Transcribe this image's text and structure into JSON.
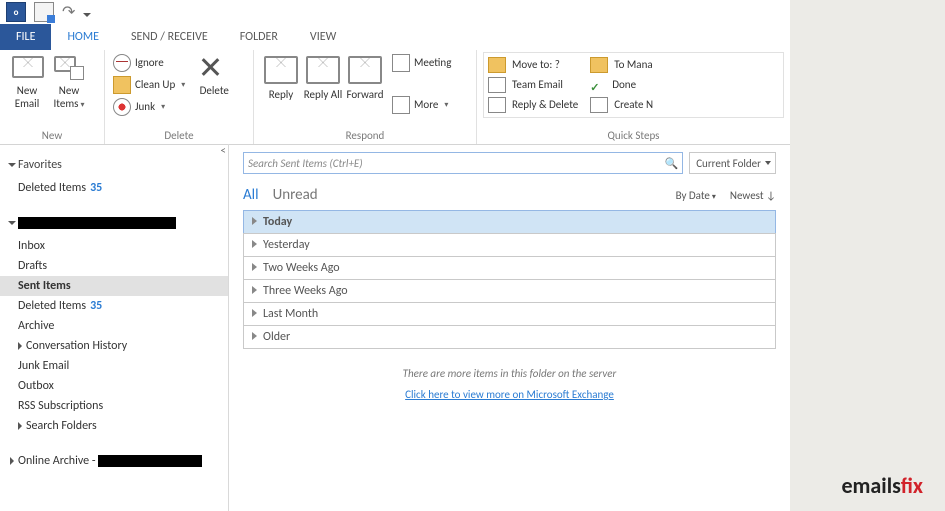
{
  "tabs": [
    "FILE",
    "HOME",
    "SEND / RECEIVE",
    "FOLDER",
    "VIEW"
  ],
  "ribbon": {
    "new": {
      "group": "New",
      "newEmail": "New Email",
      "newItems": "New Items"
    },
    "delete": {
      "group": "Delete",
      "ignore": "Ignore",
      "cleanup": "Clean Up",
      "junk": "Junk",
      "delete": "Delete"
    },
    "respond": {
      "group": "Respond",
      "reply": "Reply",
      "replyAll": "Reply All",
      "forward": "Forward",
      "meeting": "Meeting",
      "more": "More"
    },
    "qs": {
      "group": "Quick Steps",
      "moveTo": "Move to: ?",
      "teamEmail": "Team Email",
      "replyDelete": "Reply & Delete",
      "toManager": "To Mana",
      "done": "Done",
      "createNew": "Create N"
    }
  },
  "nav": {
    "favorites": "Favorites",
    "favItems": [
      {
        "label": "Deleted Items",
        "count": "35"
      }
    ],
    "folders": [
      "Inbox",
      "Drafts",
      "Sent Items",
      "Deleted Items",
      "Archive",
      "Conversation History",
      "Junk Email",
      "Outbox",
      "RSS Subscriptions",
      "Search Folders"
    ],
    "deletedCount": "35",
    "onlineArchive": "Online Archive -"
  },
  "search": {
    "placeholder": "Search Sent Items (Ctrl+E)",
    "scope": "Current Folder"
  },
  "list": {
    "filters": [
      "All",
      "Unread"
    ],
    "sortBy": "By Date",
    "sortDir": "Newest",
    "groups": [
      "Today",
      "Yesterday",
      "Two Weeks Ago",
      "Three Weeks Ago",
      "Last Month",
      "Older"
    ],
    "moreMsg": "There are more items in this folder on the server",
    "moreLink": "Click here to view more on Microsoft Exchange"
  },
  "brand": {
    "part1": "emails",
    "part2": "fix"
  }
}
